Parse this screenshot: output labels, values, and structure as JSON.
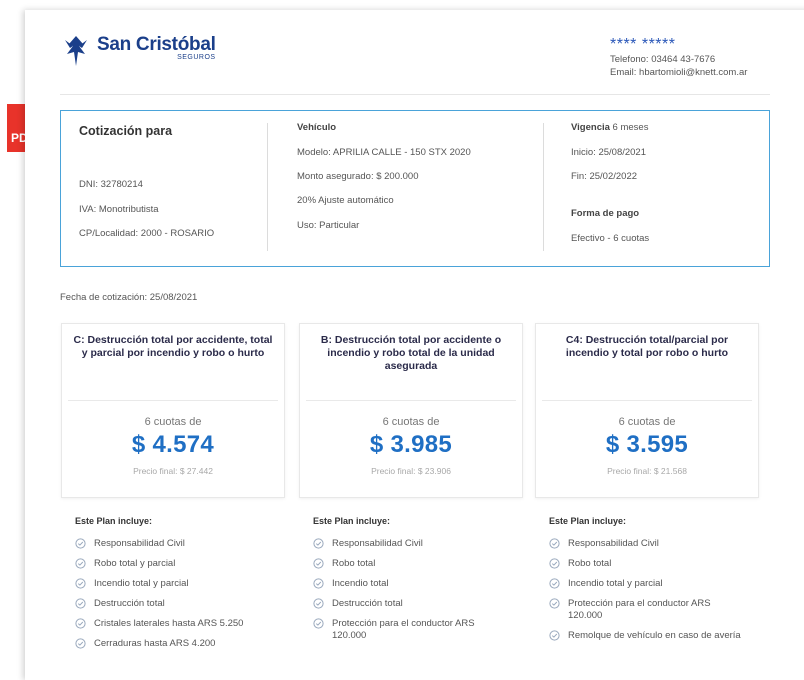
{
  "pdf_badge": {
    "label": "PDF",
    "color": "#e8332a"
  },
  "header": {
    "brand": "San Cristóbal",
    "brand_sub": "SEGUROS",
    "masked_name": "**** *****",
    "telefono": "Telefono: 03464 43-7676",
    "email": "Email: hbartomioli@knett.com.ar"
  },
  "quote": {
    "title": "Cotización para",
    "dni": "DNI: 32780214",
    "iva": "IVA: Monotributista",
    "cp": "CP/Localidad: 2000 - ROSARIO",
    "vehiculo_label": "Vehículo",
    "modelo": "Modelo: APRILIA CALLE - 150 STX 2020",
    "monto": "Monto asegurado: $ 200.000",
    "ajuste": "20% Ajuste automático",
    "uso": "Uso: Particular",
    "vigencia_label": "Vigencia",
    "vigencia_value": "6 meses",
    "inicio": "Inicio: 25/08/2021",
    "fin": "Fin: 25/02/2022",
    "pago_label": "Forma de pago",
    "pago_value": "Efectivo - 6 cuotas"
  },
  "fecha_cotizacion": "Fecha de cotización: 25/08/2021",
  "plans": [
    {
      "title": "C: Destrucción total por accidente, total y parcial por incendio y robo o hurto",
      "cuotas": "6 cuotas de",
      "price": "$ 4.574",
      "final": "Precio final: $ 27.442"
    },
    {
      "title": "B: Destrucción total por accidente o incendio y robo total de la unidad asegurada",
      "cuotas": "6 cuotas de",
      "price": "$ 3.985",
      "final": "Precio final: $ 23.906"
    },
    {
      "title": "C4: Destrucción total/parcial por incendio y total por robo o hurto",
      "cuotas": "6 cuotas de",
      "price": "$ 3.595",
      "final": "Precio final: $ 21.568"
    }
  ],
  "includes": [
    {
      "title": "Este Plan incluye:",
      "items": [
        "Responsabilidad Civil",
        "Robo total y parcial",
        "Incendio total y parcial",
        "Destrucción total",
        "Cristales laterales hasta ARS 5.250",
        "Cerraduras hasta ARS 4.200"
      ]
    },
    {
      "title": "Este Plan incluye:",
      "items": [
        "Responsabilidad Civil",
        "Robo total",
        "Incendio total",
        "Destrucción total",
        "Protección para el conductor ARS 120.000"
      ]
    },
    {
      "title": "Este Plan incluye:",
      "items": [
        "Responsabilidad Civil",
        "Robo total",
        "Incendio total y parcial",
        "Protección para el conductor ARS 120.000",
        "Remolque de vehículo en caso de avería"
      ]
    }
  ],
  "colors": {
    "accent": "#1f6fc4",
    "border": "#4aa3d9",
    "brand": "#1b3f8a"
  }
}
